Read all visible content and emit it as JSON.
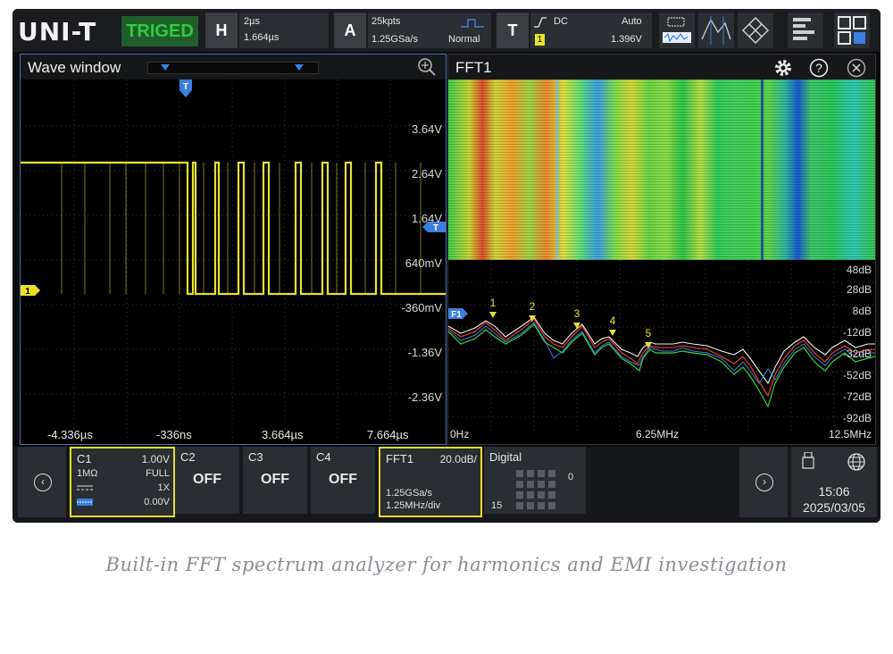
{
  "topbar": {
    "logo": "UNI-T",
    "trigger_state": "TRIGED",
    "horizontal": {
      "letter": "H",
      "timebase": "2µs",
      "position": "1.664µs"
    },
    "acquire": {
      "letter": "A",
      "depth": "25kpts",
      "sample_rate": "1.25GSa/s",
      "mode": "Normal"
    },
    "trigger": {
      "letter": "T",
      "coupling": "DC",
      "source": "1",
      "sweep": "Auto",
      "level": "1.396V"
    },
    "icons": [
      "measure-icon",
      "cursor-icon",
      "math-icon",
      "menu-icon",
      "layout-icon"
    ]
  },
  "wave_window": {
    "title": "Wave window",
    "zoom_icon": "zoom-in-icon",
    "trigger_marker": "T",
    "channel_marker": "1",
    "level_marker": "T",
    "y_labels": [
      "3.64V",
      "2.64V",
      "1.64V",
      "640mV",
      "-360mV",
      "-1.36V",
      "-2.36V"
    ],
    "x_labels": [
      "-4.336µs",
      "-336ns",
      "3.664µs",
      "7.664µs"
    ]
  },
  "fft": {
    "title": "FFT1",
    "marker_label": "F1",
    "db_labels": [
      "48dB",
      "28dB",
      "8dB",
      "-12dB",
      "-32dB",
      "-52dB",
      "-72dB",
      "-92dB"
    ],
    "freq_labels": [
      "0Hz",
      "6.25MHz",
      "12.5MHz"
    ],
    "peak_markers": [
      "1",
      "2",
      "3",
      "4",
      "5"
    ]
  },
  "bottom": {
    "c1": {
      "name": "C1",
      "scale": "1.00V",
      "impedance": "1MΩ",
      "bandwidth": "FULL",
      "probe": "1X",
      "offset": "0.00V"
    },
    "c2": {
      "name": "C2",
      "state": "OFF"
    },
    "c3": {
      "name": "C3",
      "state": "OFF"
    },
    "c4": {
      "name": "C4",
      "state": "OFF"
    },
    "fft1": {
      "name": "FFT1",
      "scale": "20.0dB/",
      "rate": "1.25GSa/s",
      "span": "1.25MHz/div"
    },
    "digital": {
      "name": "Digital",
      "hi": "0",
      "lo": "15"
    },
    "time": "15:06",
    "date": "2025/03/05"
  },
  "caption": "Built-in FFT spectrum analyzer for harmonics and EMI investigation",
  "colors": {
    "ch1": "#e8e12c",
    "accent_blue": "#3b7fe0",
    "fft_red": "#d83a2b",
    "fft_green": "#33d44a"
  }
}
